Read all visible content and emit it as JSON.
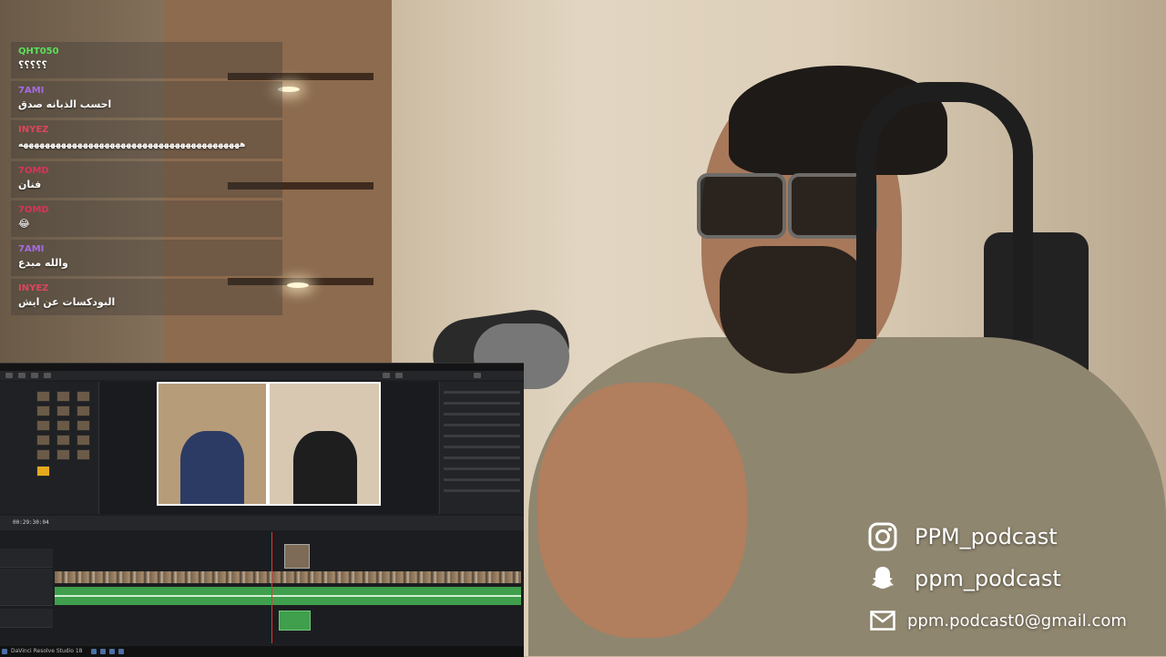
{
  "chat": {
    "messages": [
      {
        "user": "QHT050",
        "text": "؟؟؟؟؟",
        "color": "#5be05b"
      },
      {
        "user": "7AMI",
        "text": "احسب الذبانه صدق",
        "color": "#a56be0"
      },
      {
        "user": "INYEZ",
        "text": "هههههههههههههههههههههههههههههههههههههههههه",
        "color": "#e0445b",
        "long": true
      },
      {
        "user": "7OMD",
        "text": "فنان",
        "color": "#d9345a"
      },
      {
        "user": "7OMD",
        "text": "😂",
        "color": "#d9345a"
      },
      {
        "user": "7AMI",
        "text": "والله مبدع",
        "color": "#a56be0"
      },
      {
        "user": "INYEZ",
        "text": "البودكسات عن ايش",
        "color": "#e0445b"
      }
    ]
  },
  "editor": {
    "timecode": "00:29:30:04",
    "taskbar_label": "DaVinci Resolve Studio 18"
  },
  "socials": {
    "instagram": "PPM_podcast",
    "snapchat": "ppm_podcast",
    "email": "ppm.podcast0@gmail.com",
    "icons": [
      "instagram-icon",
      "snapchat-icon",
      "mail-icon"
    ]
  }
}
